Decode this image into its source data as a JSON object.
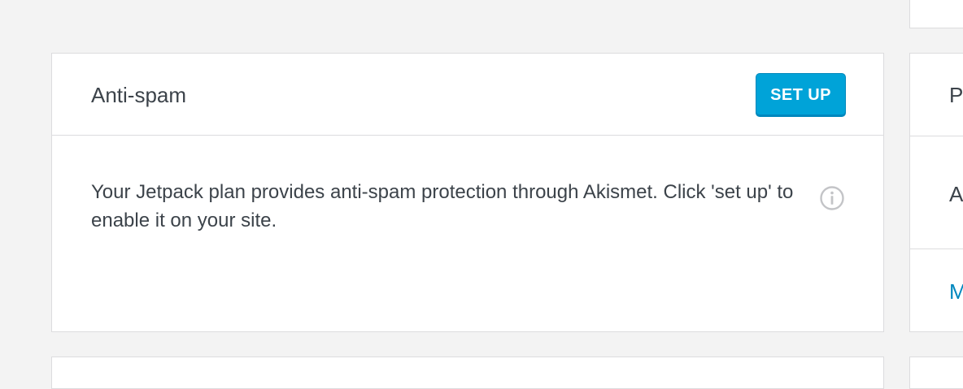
{
  "antispam_card": {
    "title": "Anti-spam",
    "setup_button_label": "SET UP",
    "description": "Your Jetpack plan provides anti-spam protection through Akismet. Click 'set up' to enable it on your site.",
    "info_icon": "info-icon"
  },
  "side_card": {
    "row1_text": "P",
    "row2_text": "A",
    "link_text": "M"
  },
  "colors": {
    "button_bg": "#00a3d8",
    "link": "#0087be",
    "page_bg": "#f3f3f3",
    "border": "#dcdcde"
  }
}
